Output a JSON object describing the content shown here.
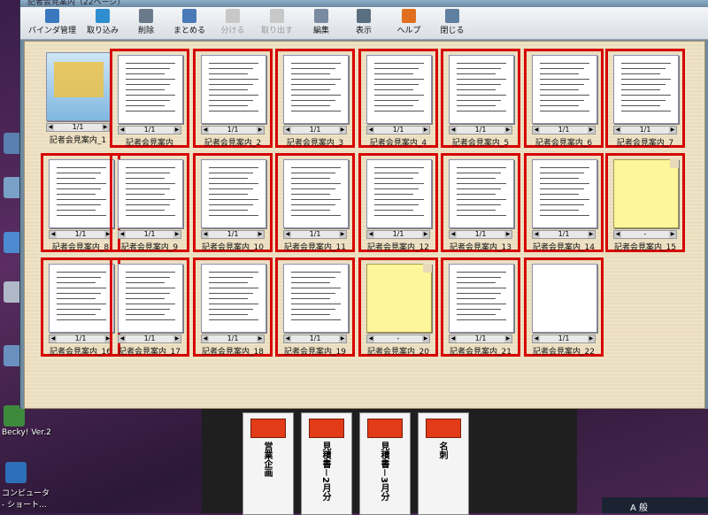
{
  "window": {
    "title": "記者会見案内（22ページ）"
  },
  "toolbar": [
    {
      "label": "バインダ管理",
      "icon": "binder-icon",
      "enabled": true
    },
    {
      "label": "取り込み",
      "icon": "import-icon",
      "enabled": true
    },
    {
      "label": "削除",
      "icon": "trash-icon",
      "enabled": true
    },
    {
      "label": "まとめる",
      "icon": "merge-icon",
      "enabled": true
    },
    {
      "label": "分ける",
      "icon": "split-icon",
      "enabled": false
    },
    {
      "label": "取り出す",
      "icon": "extract-icon",
      "enabled": false
    },
    {
      "label": "編集",
      "icon": "edit-icon",
      "enabled": true
    },
    {
      "label": "表示",
      "icon": "view-icon",
      "enabled": true
    },
    {
      "label": "ヘルプ",
      "icon": "help-icon",
      "enabled": true
    },
    {
      "label": "閉じる",
      "icon": "close-icon",
      "enabled": true
    }
  ],
  "documents": [
    {
      "label": "記者会見案内_1",
      "page": "1/1",
      "kind": "color",
      "selected": false
    },
    {
      "label": "記者会見案内",
      "page": "1/1",
      "kind": "doc",
      "selected": true
    },
    {
      "label": "記者会見案内_2",
      "page": "1/1",
      "kind": "doc",
      "selected": true
    },
    {
      "label": "記者会見案内_3",
      "page": "1/1",
      "kind": "doc",
      "selected": true
    },
    {
      "label": "記者会見案内_4",
      "page": "1/1",
      "kind": "doc",
      "selected": true
    },
    {
      "label": "記者会見案内_5",
      "page": "1/1",
      "kind": "doc",
      "selected": true
    },
    {
      "label": "記者会見案内_6",
      "page": "1/1",
      "kind": "doc",
      "selected": true
    },
    {
      "label": "記者会見案内_7",
      "page": "1/1",
      "kind": "doc",
      "selected": true
    },
    {
      "label": "記者会見案内_8",
      "page": "1/1",
      "kind": "doc",
      "selected": true
    },
    {
      "label": "記者会見案内_9",
      "page": "1/1",
      "kind": "doc",
      "selected": true
    },
    {
      "label": "記者会見案内_10",
      "page": "1/1",
      "kind": "doc",
      "selected": true
    },
    {
      "label": "記者会見案内_11",
      "page": "1/1",
      "kind": "doc",
      "selected": true
    },
    {
      "label": "記者会見案内_12",
      "page": "1/1",
      "kind": "doc",
      "selected": true
    },
    {
      "label": "記者会見案内_13",
      "page": "1/1",
      "kind": "doc",
      "selected": true
    },
    {
      "label": "記者会見案内_14",
      "page": "1/1",
      "kind": "doc",
      "selected": true
    },
    {
      "label": "記者会見案内_15",
      "page": "-",
      "kind": "yellow",
      "selected": true
    },
    {
      "label": "記者会見案内_16",
      "page": "1/1",
      "kind": "doc",
      "selected": true
    },
    {
      "label": "記者会見案内_17",
      "page": "1/1",
      "kind": "doc",
      "selected": true
    },
    {
      "label": "記者会見案内_18",
      "page": "1/1",
      "kind": "doc",
      "selected": true
    },
    {
      "label": "記者会見案内_19",
      "page": "1/1",
      "kind": "doc",
      "selected": true
    },
    {
      "label": "記者会見案内_20",
      "page": "-",
      "kind": "yellow",
      "selected": true
    },
    {
      "label": "記者会見案内_21",
      "page": "1/1",
      "kind": "doc",
      "selected": true
    },
    {
      "label": "記者会見案内_22",
      "page": "1/1",
      "kind": "blank",
      "selected": true
    }
  ],
  "binders": [
    {
      "label": "営業企画"
    },
    {
      "label": "見積書－2月分"
    },
    {
      "label": "見積書－3月分"
    },
    {
      "label": "名刺"
    }
  ],
  "desktop": {
    "icon_label_1": "Becky! Ver.2",
    "icon_label_2": "コンピュータ - ショート..."
  },
  "taskbar": {
    "ime": "A 般"
  }
}
